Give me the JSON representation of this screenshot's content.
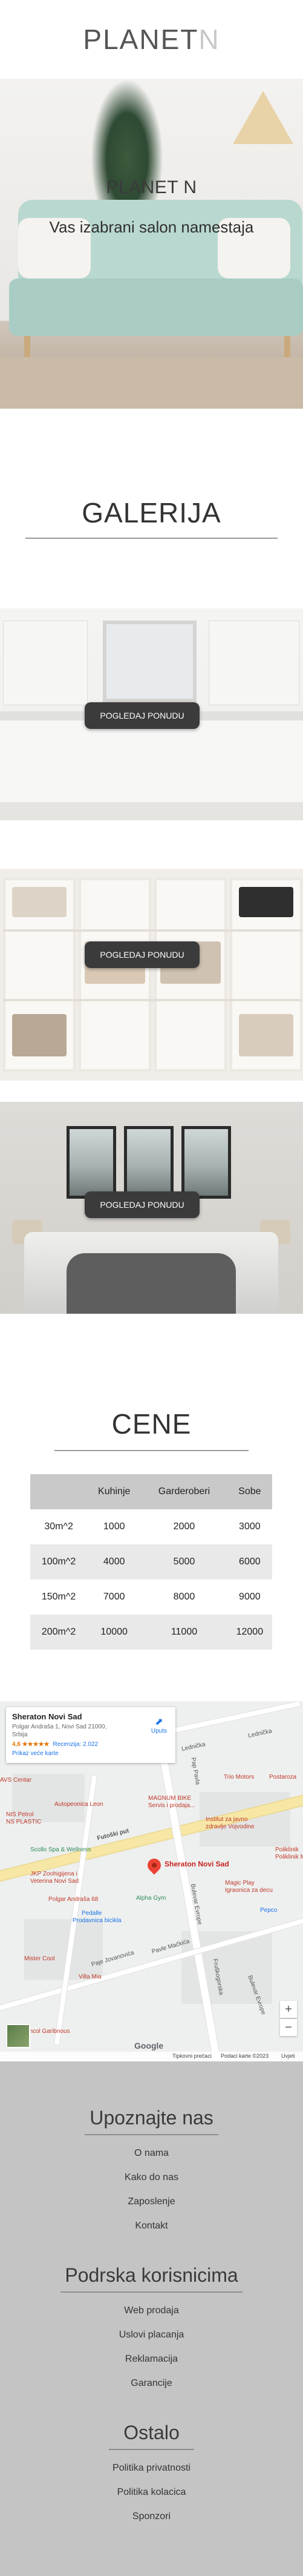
{
  "header": {
    "logo_main": "PLANET",
    "logo_accent": "N"
  },
  "hero": {
    "title": "PLANET N",
    "subtitle": "Vas izabrani salon namestaja"
  },
  "gallery": {
    "title": "GALERIJA",
    "items": [
      {
        "button": "POGLEDAJ PONUDU"
      },
      {
        "button": "POGLEDAJ PONUDU"
      },
      {
        "button": "POGLEDAJ PONUDU"
      }
    ]
  },
  "prices": {
    "title": "CENE",
    "headers": [
      "",
      "Kuhinje",
      "Garderoberi",
      "Sobe"
    ],
    "rows": [
      [
        "30m^2",
        "1000",
        "2000",
        "3000"
      ],
      [
        "100m^2",
        "4000",
        "5000",
        "6000"
      ],
      [
        "150m^2",
        "7000",
        "8000",
        "9000"
      ],
      [
        "200m^2",
        "10000",
        "11000",
        "12000"
      ]
    ]
  },
  "map": {
    "place_name": "Sheraton Novi Sad",
    "address_line1": "Polgar Andraša 1, Novi Sad 21000,",
    "address_line2": "Srbija",
    "rating": "4,6 ★★★★★",
    "reviews": "Recenzija: 2.022",
    "larger_map": "Prikaz veće karte",
    "directions": "Uputs",
    "pin_label": "Sheraton Novi Sad",
    "labels": {
      "l1": "Lednička",
      "l2": "Lednička",
      "l3": "Futoški put",
      "l4": "Bulevar Evrope",
      "l5": "Pap Pavla",
      "l6": "Paje Jovanovića",
      "l7": "Pavle Mačkića",
      "l8": "Fruškogorska",
      "l9": "Bulevar Evrope"
    },
    "pois": {
      "p1": "AVS Centar",
      "p2": "Trio Motors",
      "p3": "Autopeonica Leon",
      "p4": "MAGNUM BIKE",
      "p5": "Servis i prodaja...",
      "p6": "NIS Petrol",
      "p7": "NS PLASTIC",
      "p8": "Institut za javno",
      "p9": "zdravlje Vojvodine",
      "p10": "Scollo Spa & Wellness",
      "p11": "JKP Zoohigijena i",
      "p12": "Veterina Novi Sad",
      "p13": "Polgar Andraša 68",
      "p14": "Pedalle",
      "p15": "Prodavnica bicikla",
      "p16": "Alpha Gym",
      "p17": "Magic Play",
      "p18": "Igraonica za decu",
      "p19": "Mister Cool",
      "p20": "Villa Mia",
      "p21": "Pepco",
      "p22": "Cairncol Garibnous",
      "p23": "Poliklinik",
      "p24": "Poliklinik MD - Na",
      "p25": "Postaroza"
    },
    "zoom_in": "+",
    "zoom_out": "−",
    "google": "Google",
    "footer_shortcuts": "Tipkovni prečaci",
    "footer_data": "Podaci karte ©2023",
    "footer_terms": "Uvjeti"
  },
  "footer": {
    "sections": [
      {
        "title": "Upoznajte nas",
        "links": [
          "O nama",
          "Kako do nas",
          "Zaposlenje",
          "Kontakt"
        ]
      },
      {
        "title": "Podrska korisnicima",
        "links": [
          "Web prodaja",
          "Uslovi placanja",
          "Reklamacija",
          "Garancije"
        ]
      },
      {
        "title": "Ostalo",
        "links": [
          "Politika privatnosti",
          "Politika kolacica",
          "Sponzori"
        ]
      }
    ]
  },
  "colors": {
    "table_header": "#c9c9c9",
    "table_alt": "#e9e9e9",
    "footer_bg": "#c4c4c4",
    "button_bg": "#3b3b3b"
  }
}
